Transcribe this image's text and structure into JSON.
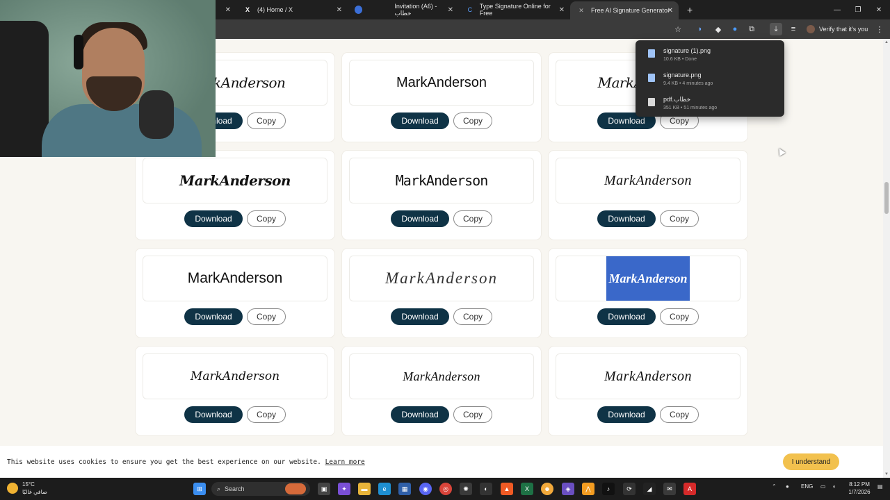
{
  "browser": {
    "tabs": [
      {
        "title": "",
        "icon": "tab-icon"
      },
      {
        "title": "(4) Home / X",
        "icon": "x-logo-icon"
      },
      {
        "title": "",
        "icon": "edge-icon"
      },
      {
        "title": "Invitation (A6) - خطاب",
        "icon": "canva-icon"
      },
      {
        "title": "Type Signature Online for Free",
        "icon": "signature-site-icon"
      },
      {
        "title": "Free AI Signature Generator",
        "icon": "signature-site-icon"
      }
    ],
    "new_tab": "+",
    "window_controls": [
      "—",
      "❐",
      "✕"
    ],
    "verify_label": "Verify that it's you"
  },
  "downloads": [
    {
      "name": "signature (1).png",
      "meta": "10.6 KB • Done",
      "icon": "image-file-icon"
    },
    {
      "name": "signature.png",
      "meta": "9.4 KB • 4 minutes ago",
      "icon": "image-file-icon"
    },
    {
      "name": "pdf.خطاب",
      "meta": "351 KB • 51 minutes ago",
      "icon": "pdf-file-icon"
    }
  ],
  "signatures": [
    {
      "text": "MarkAnderson",
      "style": "s1"
    },
    {
      "text": "MarkAnderson",
      "style": "s2"
    },
    {
      "text": "MarkAnderson",
      "style": "s1"
    },
    {
      "text": "MarkAnderson",
      "style": "s3"
    },
    {
      "text": "MarkAnderson",
      "style": "s4"
    },
    {
      "text": "MarkAnderson",
      "style": "s5"
    },
    {
      "text": "MarkAnderson",
      "style": "s6"
    },
    {
      "text": "MarkAnderson",
      "style": "s7"
    },
    {
      "text": "MarkAnderson",
      "style": "s8"
    },
    {
      "text": "MarkAnderson",
      "style": "s9"
    },
    {
      "text": "MarkAnderson",
      "style": "s10"
    },
    {
      "text": "MarkAnderson",
      "style": "s5"
    }
  ],
  "buttons": {
    "download": "Download",
    "copy": "Copy"
  },
  "cookie": {
    "text": "This website uses cookies to ensure you get the best experience on our website.",
    "link": "Learn more",
    "accept": "I understand"
  },
  "taskbar": {
    "weather_temp": "15°C",
    "weather_desc": "صافي غالبًا",
    "search_label": "Search",
    "lang": "ENG",
    "time": "8:12 PM",
    "date": "1/7/2026"
  },
  "colors": {
    "download_button": "#0f3346",
    "highlight_preview": "#3a68c9",
    "accept_button": "#f2c14e"
  }
}
